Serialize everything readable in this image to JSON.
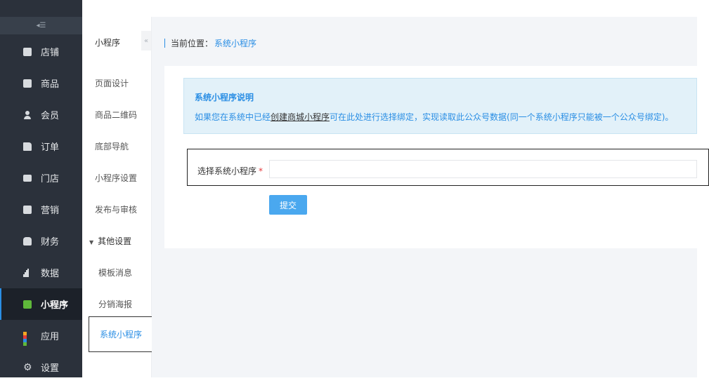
{
  "sidebar": {
    "collapse_icon": "◂☰",
    "items": [
      {
        "label": "店铺",
        "icon": "store-icon"
      },
      {
        "label": "商品",
        "icon": "goods-icon"
      },
      {
        "label": "会员",
        "icon": "member-icon"
      },
      {
        "label": "订单",
        "icon": "order-icon"
      },
      {
        "label": "门店",
        "icon": "branch-store-icon"
      },
      {
        "label": "营销",
        "icon": "gift-icon"
      },
      {
        "label": "财务",
        "icon": "money-bag-icon"
      },
      {
        "label": "数据",
        "icon": "bar-chart-icon"
      },
      {
        "label": "小程序",
        "icon": "mini-program-icon",
        "active": true
      },
      {
        "label": "应用",
        "icon": "apps-icon"
      },
      {
        "label": "设置",
        "icon": "gear-icon"
      }
    ]
  },
  "submenu": {
    "title": "小程序",
    "collapse_icon": "«",
    "items": [
      "页面设计",
      "商品二维码",
      "底部导航",
      "小程序设置",
      "发布与审核"
    ],
    "group": {
      "label": "其他设置",
      "children": [
        "模板消息",
        "分销海报",
        "系统小程序"
      ]
    }
  },
  "breadcrumb": {
    "prefix": "当前位置：",
    "current": "系统小程序"
  },
  "notice": {
    "title": "系统小程序说明",
    "text_before": "如果您在系统中已经",
    "link": "创建商城小程序",
    "text_after": "可在此处进行选择绑定，实现读取此公众号数据(同一个系统小程序只能被一个公众号绑定)。"
  },
  "form": {
    "label": "选择系统小程序",
    "required_mark": "*",
    "value": "",
    "submit_label": "提交"
  },
  "colors": {
    "accent": "#2a8ee4",
    "sidebar_bg": "#2b313b",
    "button": "#4aa8ef",
    "notice_bg": "#e2f1f9"
  }
}
